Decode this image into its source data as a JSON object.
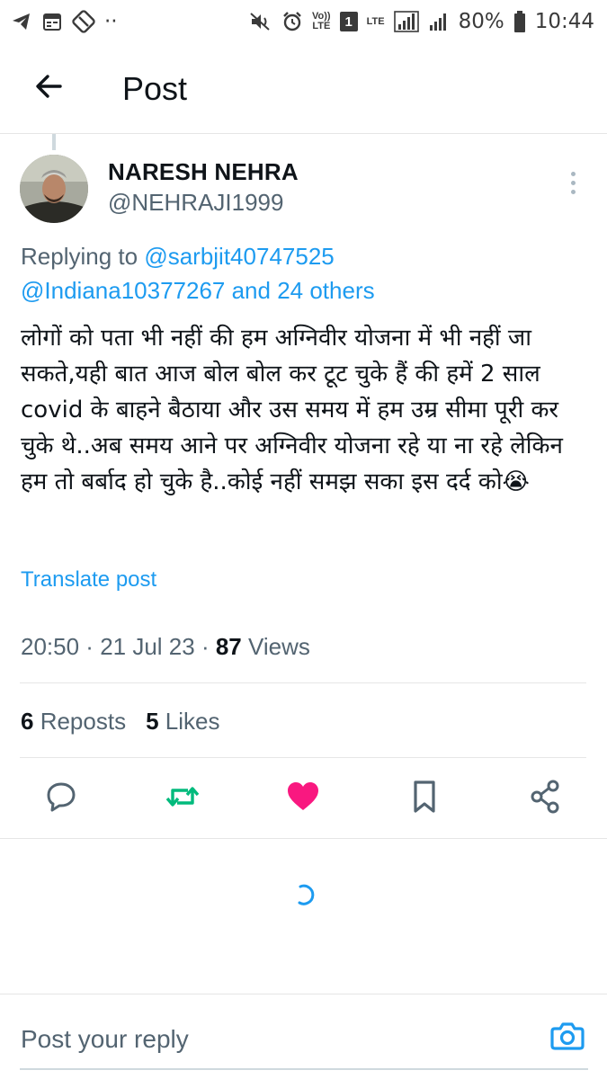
{
  "status_bar": {
    "battery": "80%",
    "time": "10:44",
    "volte": "Vo))\nLTE",
    "sim_badge": "1",
    "lte_label": "LTE",
    "dots": "··"
  },
  "header": {
    "title": "Post"
  },
  "post": {
    "author_name": "NARESH NEHRA",
    "author_handle": "@NEHRAJI1999",
    "replying_prefix": "Replying to ",
    "replying_to_1": "@sarbjit40747525",
    "replying_to_2": "@Indiana10377267",
    "replying_and_others": " and 24 others",
    "text": "लोगों को पता भी नहीं की हम अग्निवीर योजना में भी नहीं जा सकते,यही बात आज बोल बोल कर टूट चुके हैं की हमें 2 साल covid के बाहने बैठाया और उस समय में हम उम्र सीमा पूरी कर चुके थे..अब समय आने पर अग्निवीर योजना रहे या ना रहे लेकिन हम तो बर्बाद हो चुके है..कोई नहीं समझ सका इस दर्द को😭",
    "translate_label": "Translate post",
    "time": "20:50",
    "date": "21 Jul 23",
    "views_count": "87",
    "views_label": " Views",
    "separator": " · "
  },
  "stats": {
    "reposts_count": "6",
    "reposts_label": " Reposts",
    "likes_count": "5",
    "likes_label": " Likes"
  },
  "colors": {
    "accent": "#1d9bf0",
    "repost": "#00ba7c",
    "like": "#f91880",
    "text_secondary": "#536471"
  },
  "reply": {
    "placeholder": "Post your reply"
  },
  "icons": [
    "telegram-icon",
    "calendar-icon",
    "no-sign-icon",
    "mute-icon",
    "alarm-icon",
    "signal-icon",
    "battery-icon",
    "back-arrow-icon",
    "more-vertical-icon",
    "reply-icon",
    "repost-icon",
    "like-icon",
    "bookmark-icon",
    "share-icon",
    "loading-spinner-icon",
    "camera-icon"
  ]
}
